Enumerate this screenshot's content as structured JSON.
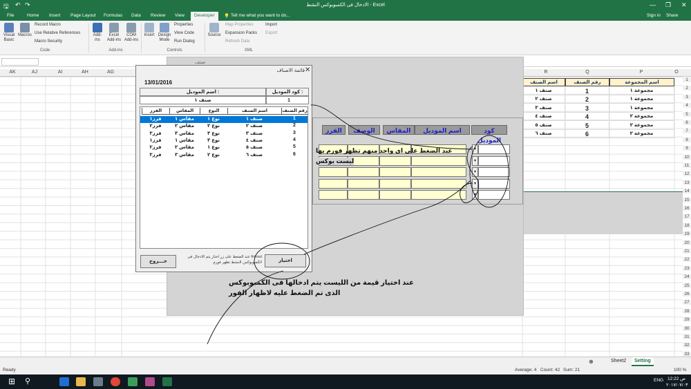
{
  "window": {
    "title": "الادخال فى الكمبوبوكس النشط - Excel",
    "controls": [
      "—",
      "❐",
      "✕"
    ]
  },
  "ribbon_tabs": [
    "File",
    "Home",
    "Insert",
    "Page Layout",
    "Formulas",
    "Data",
    "Review",
    "View",
    "Developer"
  ],
  "tell_me": "Tell me what you want to do...",
  "sign_in": "Sign in",
  "share": "Share",
  "ribbon": {
    "visual_basic": "Visual Basic",
    "macros": "Macros",
    "record_macro": "Record Macro",
    "relative_refs": "Use Relative References",
    "macro_security": "Macro Security",
    "group_code": "Code",
    "addins": "Add-ins",
    "excel_addins": "Excel Add-ins",
    "com_addins": "COM Add-ins",
    "group_addins": "Add-ins",
    "insert": "Insert",
    "design_mode": "Design Mode",
    "properties": "Properties",
    "view_code": "View Code",
    "run_dialog": "Run Dialog",
    "group_controls": "Controls",
    "source": "Source",
    "map_properties": "Map Properties",
    "expansion_packs": "Expansion Packs",
    "refresh_data": "Refresh Data",
    "import": "Import",
    "export": "Export",
    "group_xml": "XML"
  },
  "col_headers": [
    "AK",
    "AJ",
    "AI",
    "AH",
    "AG",
    "R",
    "Q",
    "P",
    "O"
  ],
  "row_numbers": [
    "1",
    "2",
    "3",
    "4",
    "5",
    "6",
    "7",
    "8",
    "9",
    "10",
    "11",
    "12",
    "13",
    "14",
    "15",
    "16",
    "17",
    "18",
    "19",
    "20",
    "21",
    "22",
    "23",
    "24",
    "25",
    "26",
    "27",
    "28",
    "29",
    "30",
    "31",
    "32",
    "33"
  ],
  "sheet": {
    "headers": [
      "اسم الصنف",
      "رقم الصنف",
      "اسم المجموعة"
    ],
    "rows": [
      [
        "صنف ١",
        "1",
        "مجموعة ١"
      ],
      [
        "صنف ٢",
        "2",
        "مجموعة ١"
      ],
      [
        "صنف ٣",
        "3",
        "مجموعة ١"
      ],
      [
        "صنف ٤",
        "4",
        "مجموعة ٢"
      ],
      [
        "صنف ٥",
        "5",
        "مجموعة ٢"
      ],
      [
        "صنف ٦",
        "6",
        "مجموعة ٢"
      ]
    ]
  },
  "form2": {
    "title": "صنف",
    "columns": [
      "الفرز",
      "الوصف",
      "المقاس",
      "اسم الموديل",
      "كود الموديل"
    ],
    "note_line1": "عند الضغط على اى واحد منهم تظهر فورم بها",
    "note_line2": "ليست بوكس",
    "dd_arrow": "▾"
  },
  "dialog": {
    "title": "قائمة الاصناف",
    "close": "✕",
    "date": "13/01/2016",
    "model_name_label": "اسم الموديل :",
    "model_code_label": "كود الموديل :",
    "model_name_value": "صنف ١",
    "model_code_value": "1",
    "list_headers": [
      "الفرز",
      "المقاس",
      "النوع",
      "اسم الصنف",
      "رقم الصنف"
    ],
    "list_rows": [
      [
        "فرز١",
        "مقاس ١",
        "نوع ١",
        "صنف ١",
        "1"
      ],
      [
        "فرز٢",
        "مقاس ٢",
        "نوع ٢",
        "صنف ٢",
        "2"
      ],
      [
        "فرز٣",
        "مقاس ٣",
        "نوع ٣",
        "صنف ٣",
        "3"
      ],
      [
        "فرز١",
        "مقاس ١",
        "نوع ٣",
        "صنف ٤",
        "4"
      ],
      [
        "فرز٢",
        "مقاس ٢",
        "نوع ١",
        "صنف ٥",
        "5"
      ],
      [
        "فرز٣",
        "مقاس ٣",
        "نوع ٢",
        "صنف ٦",
        "6"
      ]
    ],
    "btn_exit": "خـــروج",
    "btn_select": "اختيار",
    "hint_line1": "عند الضغط على زر اختار يتم الادخال فى  frmout",
    "hint_line2": "الكمبوبوكس النشط  تظهر فورم"
  },
  "annotation": {
    "line1": "عند اختيار قيمة من الليست يتم ادخالها فى الكمبوبوكس",
    "line2": "الذى تم الضغط عليه لاظهار الفور"
  },
  "sheet_tabs": [
    "Sheet2",
    "Setting"
  ],
  "status": {
    "ready": "Ready",
    "average": "Average: 4",
    "count": "Count: 42",
    "sum": "Sum: 21",
    "zoom": "100 %"
  },
  "taskbar": {
    "time": "12:22 ص",
    "date": "٢٠١٧/٠٧/٠٣",
    "lang": "ENG"
  },
  "colors": {
    "excel_green": "#217346",
    "header_fill": "#fff2cc",
    "form_bg": "#d4d4d4",
    "cell_fill": "#ffffd0",
    "selected": "#0078d7"
  }
}
